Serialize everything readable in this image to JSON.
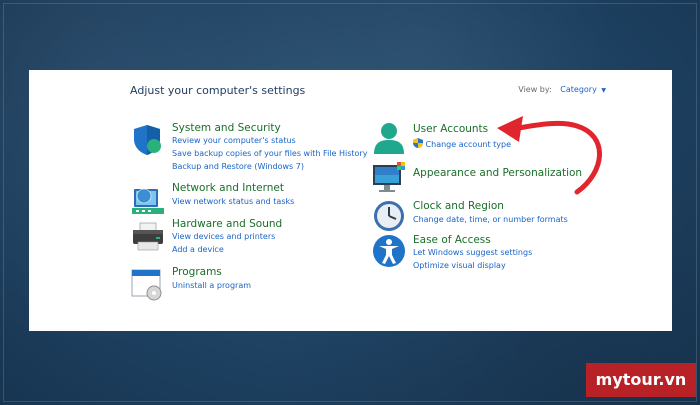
{
  "header": {
    "title": "Adjust your computer's settings",
    "view_by_label": "View by:",
    "view_by_value": "Category"
  },
  "left": [
    {
      "title": "System and Security",
      "links": [
        "Review your computer's status",
        "Save backup copies of your files with File History",
        "Backup and Restore (Windows 7)"
      ]
    },
    {
      "title": "Network and Internet",
      "links": [
        "View network status and tasks"
      ]
    },
    {
      "title": "Hardware and Sound",
      "links": [
        "View devices and printers",
        "Add a device"
      ]
    },
    {
      "title": "Programs",
      "links": [
        "Uninstall a program"
      ]
    }
  ],
  "right": [
    {
      "title": "User Accounts",
      "links": [
        "Change account type"
      ]
    },
    {
      "title": "Appearance and Personalization",
      "links": []
    },
    {
      "title": "Clock and Region",
      "links": [
        "Change date, time, or number formats"
      ]
    },
    {
      "title": "Ease of Access",
      "links": [
        "Let Windows suggest settings",
        "Optimize visual display"
      ]
    }
  ],
  "watermark": "mytour.vn",
  "colors": {
    "category_title": "#1a6e2a",
    "link": "#1a64c8",
    "arrow": "#e0262c",
    "background": "#1f4263",
    "watermark_bg": "#b82226"
  },
  "icons": [
    "shield-icon",
    "network-icon",
    "printer-icon",
    "programs-icon",
    "user-icon",
    "monitor-icon",
    "clock-icon",
    "accessibility-icon",
    "uac-shield-icon",
    "red-arrow"
  ]
}
